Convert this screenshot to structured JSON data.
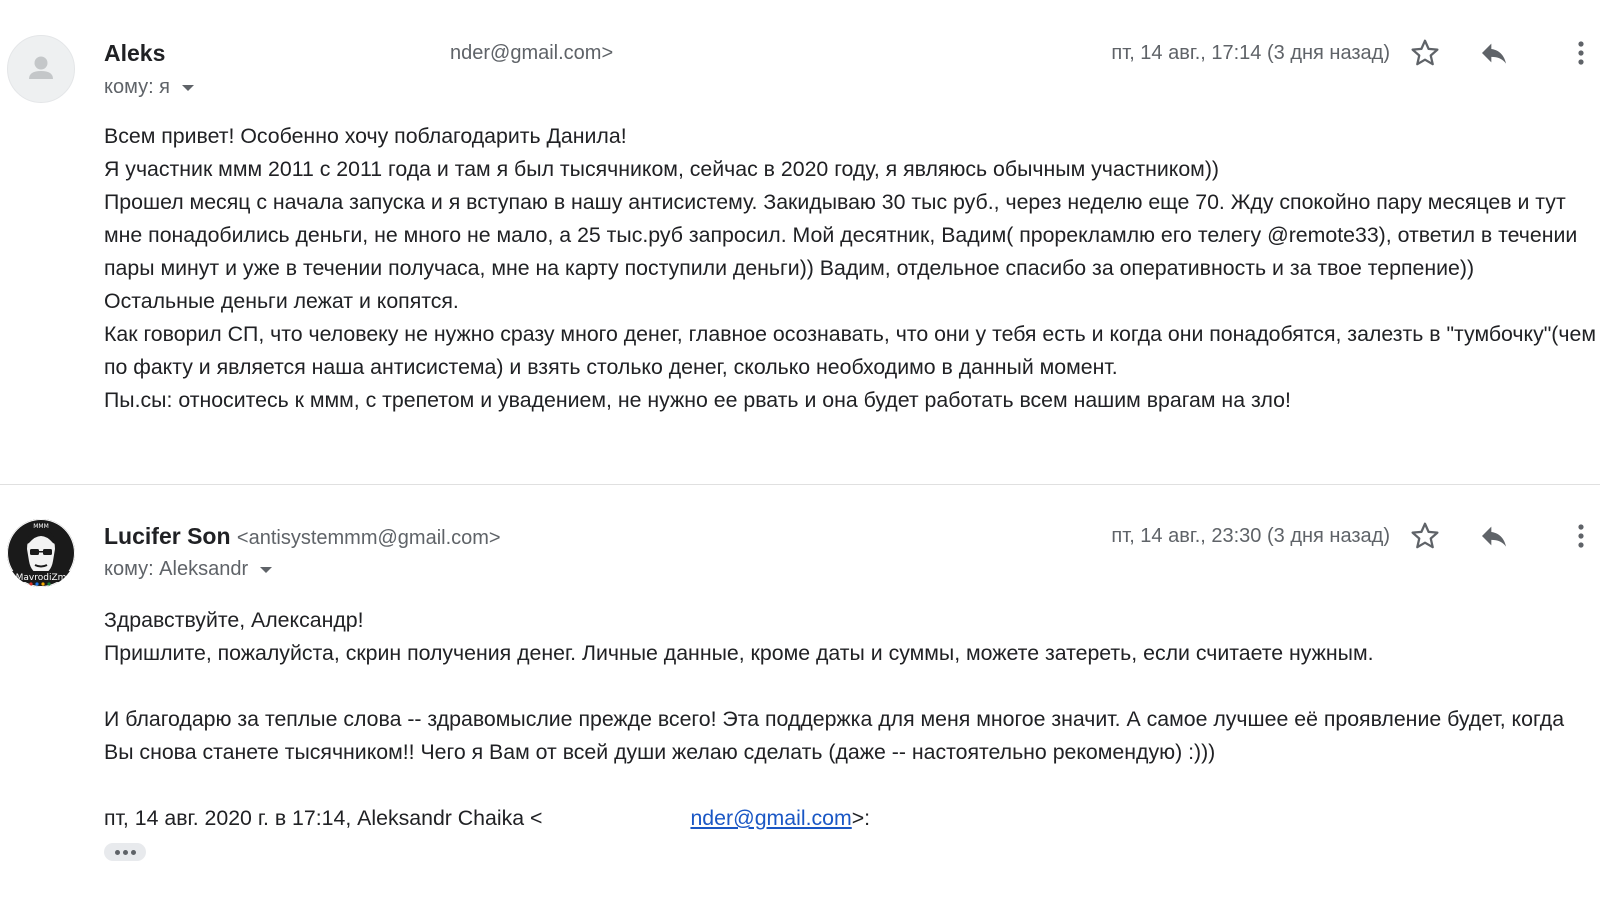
{
  "messages": [
    {
      "sender_name": "Aleks",
      "sender_email_partial": "nder@gmail.com>",
      "recipient": "кому: я",
      "date": "пт, 14 авг., 17:14 (3 дня назад)",
      "avatar_icon": "person-placeholder-icon",
      "body": [
        "Всем привет! Особенно хочу поблагодарить Данила!",
        "Я участник ммм 2011 с 2011 года и там я был тысячником, сейчас в 2020 году, я являюсь обычным участником))",
        "Прошел месяц с начала запуска и я вступаю в нашу антисистему. Закидываю 30 тыс руб., через неделю еще 70. Жду спокойно пару месяцев и тут мне понадобились деньги, не много не мало, а 25 тыс.руб запросил. Мой десятник, Вадим( прорекламлю его телегу @remote33), ответил в течении пары минут и уже в течении получаса, мне на карту поступили деньги)) Вадим, отдельное спасибо за оперативность и за твое терпение))",
        "Остальные деньги лежат и копятся.",
        "Как говорил СП, что человеку не нужно сразу много денег, главное осознавать, что они у тебя есть и когда они понадобятся, залезть в \"тумбочку\"(чем по факту и является наша антисистема) и взять столько денег, сколько необходимо в данный момент.",
        "Пы.сы: относитесь к ммм, с трепетом и увадением, не нужно ее рвать и она будет работать всем нашим врагам на зло!"
      ]
    },
    {
      "sender_name": "Lucifer Son",
      "sender_email": "<antisystemmm@gmail.com>",
      "recipient": "кому: Aleksandr",
      "date": "пт, 14 авг., 23:30 (3 дня назад)",
      "avatar_text": "MavrodiZm",
      "avatar_top_text": "МММ",
      "body": [
        "Здравствуйте, Александр!",
        "Пришлите, пожалуйста, скрин получения денег. Личные данные, кроме даты и суммы, можете затереть, если считаете нужным.",
        "",
        "И благодарю за теплые слова -- здравомыслие прежде всего! Эта поддержка для меня многое значит. А самое лучшее её проявление будет, когда Вы снова станете тысячником!! Чего я Вам от всей души желаю сделать (даже -- настоятельно рекомендую) :)))",
        ""
      ],
      "quote_prefix": "пт, 14 авг. 2020 г. в 17:14, Aleksandr Chaika <",
      "quote_link": "nder@gmail.com",
      "quote_suffix": ">:"
    }
  ],
  "icons": {
    "star": "star-icon",
    "reply": "reply-icon",
    "more": "more-vert-icon",
    "dropdown": "chevron-down-icon",
    "show_trimmed": "more-horiz-icon"
  },
  "colors": {
    "text": "#202124",
    "muted": "#5f6368",
    "link": "#1a57c5",
    "divider": "#e0e0e0"
  }
}
